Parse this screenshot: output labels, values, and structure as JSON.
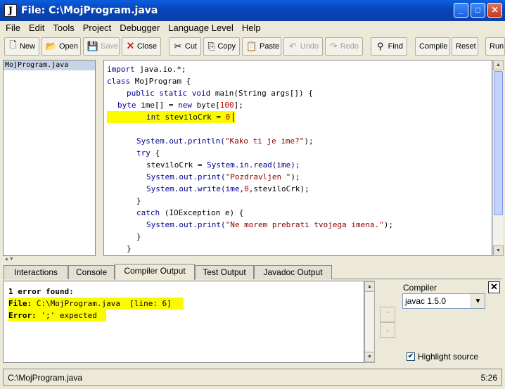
{
  "window": {
    "title": "File: C:\\MojProgram.java",
    "app_icon": "J"
  },
  "menu": [
    "File",
    "Edit",
    "Tools",
    "Project",
    "Debugger",
    "Language Level",
    "Help"
  ],
  "toolbar": {
    "new": "New",
    "open": "Open",
    "save": "Save",
    "close": "Close",
    "cut": "Cut",
    "copy": "Copy",
    "paste": "Paste",
    "undo": "Undo",
    "redo": "Redo",
    "find": "Find",
    "compile": "Compile",
    "reset": "Reset",
    "run": "Run"
  },
  "files": [
    "MojProgram.java"
  ],
  "code": {
    "l1a": "import",
    " l1b": " java.io.*;",
    "l2a": "class",
    " l2b": " MojProgram {",
    "l3a": "public static void",
    " l3b": " main(String args[]) {",
    "l4a": "byte",
    " l4b": " ime[] = ",
    "l4c": "new",
    " l4d": " byte[",
    "l4e": "100",
    "l4f": "];",
    "l5a": "int",
    " l5b": " steviloCrk = ",
    "l5c": "0",
    "l6a": "System.out.println(",
    "l6b": "\"Kako ti je ime?\"",
    "l6c": ");",
    "l7a": "try",
    " l7b": " {",
    "l8a": "steviloCrk = ",
    "l8b": "System.in.read(ime);",
    "l9a": "System.out.print(",
    "l9b": "\"Pozdravljen \"",
    "l9c": ");",
    "l10a": "System.out.write(ime,",
    "l10b": "0",
    ",l10c": ",steviloCrk);",
    "l11": "}",
    "l12a": "catch",
    " l12b": " (IOException e) {",
    "l13a": "System.out.print(",
    "l13b": "\"Ne morem prebrati tvojega imena.\"",
    "l13c": ");",
    "l14": "}",
    "l15": "}"
  },
  "tabs": [
    "Interactions",
    "Console",
    "Compiler Output",
    "Test Output",
    "Javadoc Output"
  ],
  "active_tab": "Compiler Output",
  "output": {
    "summary": "1 error found:",
    "file_label": "File:",
    "file_value": "C:\\MojProgram.java  [line: 6]",
    "error_label": "Error:",
    "error_value": "';' expected"
  },
  "compiler": {
    "label": "Compiler",
    "value": "javac 1.5.0",
    "highlight_label": "Highlight source",
    "highlight_checked": true
  },
  "status": {
    "file": "C:\\MojProgram.java",
    "position": "5:26"
  },
  "colors": {
    "highlight": "#fbfb00",
    "title_blue": "#0a5fde",
    "keyword": "#00008b",
    "string": "#8b0000"
  }
}
